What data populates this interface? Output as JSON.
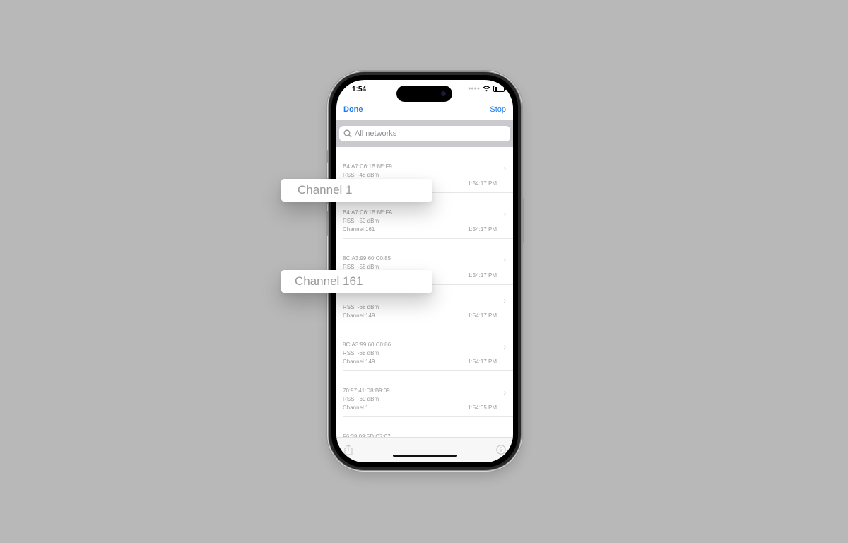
{
  "status_bar": {
    "time": "1:54",
    "signal_icon": "cellular-dots-icon",
    "wifi_icon": "wifi-icon",
    "battery_icon": "battery-low-icon"
  },
  "navbar": {
    "done_label": "Done",
    "stop_label": "Stop"
  },
  "search": {
    "placeholder": "All networks",
    "icon": "search-icon"
  },
  "accent_color": "#1a7cf0",
  "networks": [
    {
      "mac": "B4:A7:C6:1B:8E:F9",
      "rssi": "RSSI -48 dBm",
      "channel": "Channel 1",
      "time": "1:54:17 PM"
    },
    {
      "mac": "B4:A7:C6:1B:8E:FA",
      "rssi": "RSSI -50 dBm",
      "channel": "Channel 161",
      "time": "1:54:17 PM"
    },
    {
      "mac": "8C:A3:99:60:C0:85",
      "rssi": "RSSI -58 dBm",
      "channel": "Channel 161",
      "time": "1:54:17 PM"
    },
    {
      "mac": "",
      "rssi": "RSSI -68 dBm",
      "channel": "Channel 149",
      "time": "1:54:17 PM"
    },
    {
      "mac": "8C:A3:99:60:C0:86",
      "rssi": "RSSI -68 dBm",
      "channel": "Channel 149",
      "time": "1:54:17 PM"
    },
    {
      "mac": "70:97:41:D8:B9:09",
      "rssi": "RSSI -69 dBm",
      "channel": "Channel 1",
      "time": "1:54:05 PM"
    },
    {
      "mac": "F6:39:09:5D:C7:07",
      "rssi": "",
      "channel": "",
      "time": ""
    }
  ],
  "toolbar": {
    "share_icon": "share-icon",
    "info_icon": "info-icon"
  },
  "callouts": [
    {
      "label": "Channel 1"
    },
    {
      "label": "Channel 161"
    }
  ]
}
